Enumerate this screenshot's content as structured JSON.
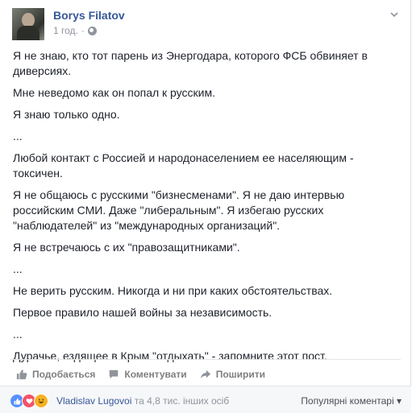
{
  "post": {
    "author": "Borys Filatov",
    "time": "1 год.",
    "icons": {
      "privacy": "globe-icon",
      "menu": "chevron-down-icon"
    },
    "paragraphs": [
      "Я не знаю, кто тот парень из Энергодара, которого ФСБ обвиняет в диверсиях.",
      "Мне неведомо как он попал к русским.",
      "Я знаю только одно.",
      "...",
      "Любой контакт с Россией и народонаселением ее населяющим - токсичен.",
      "Я не общаюсь с русскими \"бизнесменами\". Я не даю интервью российским СМИ. Даже \"либеральным\". Я избегаю русских \"наблюдателей\" из \"международных организаций\".",
      "Я не встречаюсь с их \"правозащитниками\".",
      "...",
      "Не верить русским. Никогда и ни при каких обстоятельствах.",
      "Первое правило нашей войны за независимость.",
      "...",
      "Дурачье, ездящее в Крым \"отдыхать\" - запомните этот пост."
    ]
  },
  "actions": {
    "like": "Подобається",
    "comment": "Коментувати",
    "share": "Поширити"
  },
  "footer": {
    "reactor_name": "Vladislav Lugovoi",
    "reactor_rest": " та 4,8 тис. інших осіб",
    "sort_label": "Популярні коментарі",
    "reactions": [
      "like-icon",
      "love-icon",
      "haha-icon"
    ]
  },
  "colors": {
    "link": "#365899",
    "meta": "#90949c",
    "like": "#5890ff",
    "love": "#f25268",
    "haha": "#f7b125"
  }
}
